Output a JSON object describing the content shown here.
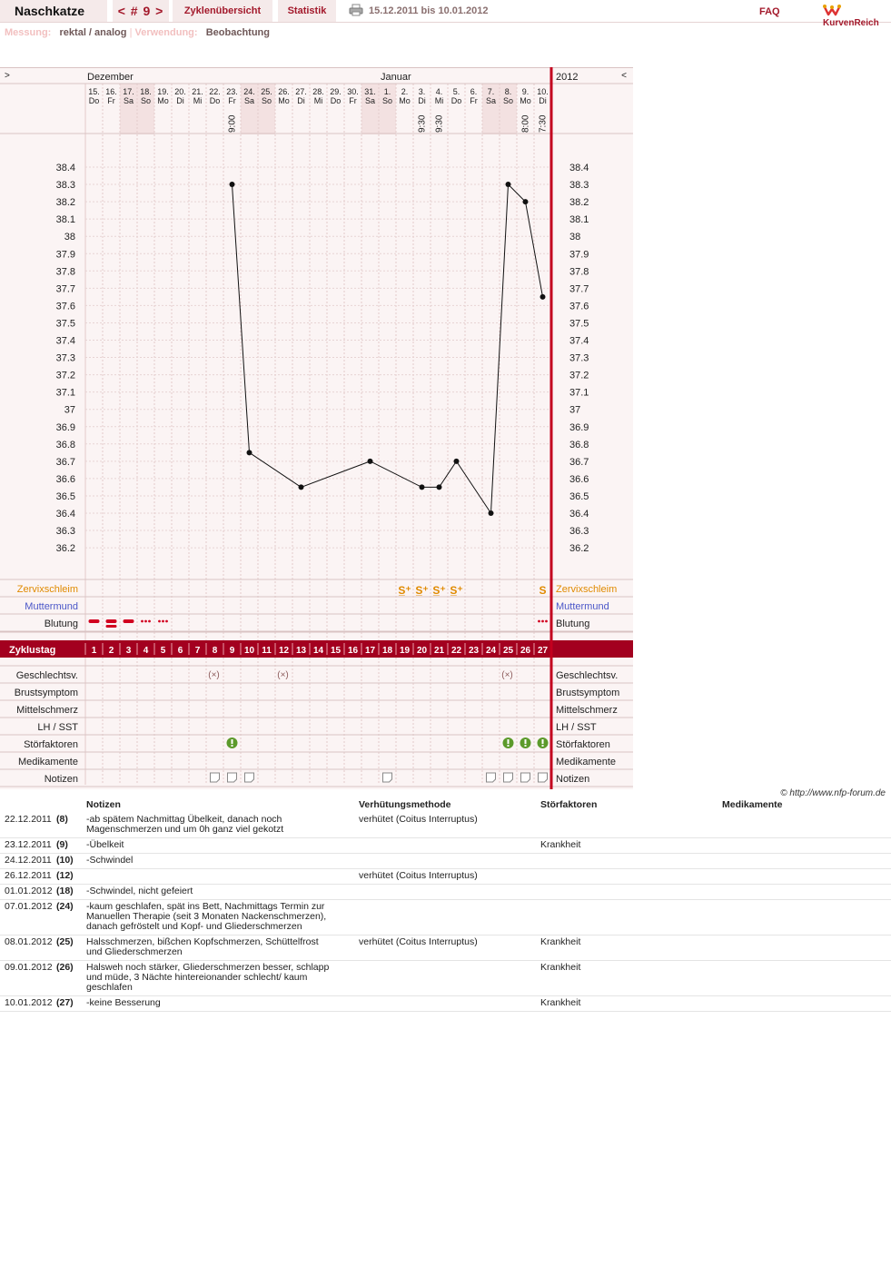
{
  "header": {
    "user": "Naschkatze",
    "cycle_nav": "< # 9 >",
    "overview_label": "Zyklenübersicht",
    "stats_label": "Statistik",
    "date_range": "15.12.2011 bis 10.01.2012",
    "faq_label": "FAQ",
    "brand": "KurvenReich"
  },
  "meta": {
    "measurement_label": "Messung:",
    "measurement_value": "rektal / analog",
    "usage_label": "Verwendung:",
    "usage_value": "Beobachtung"
  },
  "chart": {
    "nav_prev": ">",
    "nav_next": "<",
    "months": [
      "Dezember",
      "Januar"
    ],
    "year": "2012",
    "days": [
      {
        "date": "15.",
        "wd": "Do"
      },
      {
        "date": "16.",
        "wd": "Fr"
      },
      {
        "date": "17.",
        "wd": "Sa"
      },
      {
        "date": "18.",
        "wd": "So"
      },
      {
        "date": "19.",
        "wd": "Mo"
      },
      {
        "date": "20.",
        "wd": "Di"
      },
      {
        "date": "21.",
        "wd": "Mi"
      },
      {
        "date": "22.",
        "wd": "Do"
      },
      {
        "date": "23.",
        "wd": "Fr"
      },
      {
        "date": "24.",
        "wd": "Sa"
      },
      {
        "date": "25.",
        "wd": "So"
      },
      {
        "date": "26.",
        "wd": "Mo"
      },
      {
        "date": "27.",
        "wd": "Di"
      },
      {
        "date": "28.",
        "wd": "Mi"
      },
      {
        "date": "29.",
        "wd": "Do"
      },
      {
        "date": "30.",
        "wd": "Fr"
      },
      {
        "date": "31.",
        "wd": "Sa"
      },
      {
        "date": "1.",
        "wd": "So"
      },
      {
        "date": "2.",
        "wd": "Mo"
      },
      {
        "date": "3.",
        "wd": "Di"
      },
      {
        "date": "4.",
        "wd": "Mi"
      },
      {
        "date": "5.",
        "wd": "Do"
      },
      {
        "date": "6.",
        "wd": "Fr"
      },
      {
        "date": "7.",
        "wd": "Sa"
      },
      {
        "date": "8.",
        "wd": "So"
      },
      {
        "date": "9.",
        "wd": "Mo"
      },
      {
        "date": "10.",
        "wd": "Di"
      }
    ],
    "weekend_days": [
      3,
      4,
      10,
      11,
      17,
      18,
      24,
      25
    ],
    "times": [
      {
        "day": 9,
        "time": "9:00"
      },
      {
        "day": 20,
        "time": "9:30"
      },
      {
        "day": 21,
        "time": "9:30"
      },
      {
        "day": 26,
        "time": "8:00"
      },
      {
        "day": 27,
        "time": "7:30"
      }
    ],
    "y_ticks": [
      "38.4",
      "38.3",
      "38.2",
      "38.1",
      "38",
      "37.9",
      "37.8",
      "37.7",
      "37.6",
      "37.5",
      "37.4",
      "37.3",
      "37.2",
      "37.1",
      "37",
      "36.9",
      "36.8",
      "36.7",
      "36.6",
      "36.5",
      "36.4",
      "36.3",
      "36.2"
    ],
    "row_labels_left": [
      "Zervixschleim",
      "Muttermund",
      "Blutung"
    ],
    "cycle_day_label": "Zyklustag",
    "cycle_days": [
      "1",
      "2",
      "3",
      "4",
      "5",
      "6",
      "7",
      "8",
      "9",
      "10",
      "11",
      "12",
      "13",
      "14",
      "15",
      "16",
      "17",
      "18",
      "19",
      "20",
      "21",
      "22",
      "23",
      "24",
      "25",
      "26",
      "27"
    ],
    "bottom_rows": [
      "Geschlechtsv.",
      "Brustsymptom",
      "Mittelschmerz",
      "LH / SST",
      "Störfaktoren",
      "Medikamente",
      "Notizen"
    ],
    "right_labels": [
      "Zervixschleim",
      "Muttermund",
      "Blutung",
      "Geschlechtsv.",
      "Brustsymptom",
      "Mittelschmerz",
      "LH / SST",
      "Störfaktoren",
      "Medikamente",
      "Notizen"
    ],
    "colors": {
      "accent": "#a3001f",
      "mucus": "#e08a00",
      "cervix": "#4a56c8",
      "weekend": "#f3e1e1",
      "panel": "#fbf4f4"
    },
    "mucus_days": [
      19,
      20,
      21,
      22,
      27
    ],
    "mucus_symbols": [
      "S̲⁺",
      "S̲⁺",
      "S̲⁺",
      "S̲⁺",
      "S"
    ],
    "bleeding": [
      {
        "day": 1,
        "type": "heavy"
      },
      {
        "day": 2,
        "type": "heavy"
      },
      {
        "day": 3,
        "type": "heavy"
      },
      {
        "day": 4,
        "type": "spotting"
      },
      {
        "day": 5,
        "type": "spotting"
      },
      {
        "day": 27,
        "type": "spotting"
      }
    ],
    "intercourse_days": [
      8,
      12,
      25
    ],
    "disturbance_days": [
      9,
      25,
      26,
      27
    ],
    "note_days": [
      8,
      9,
      10,
      18,
      24,
      25,
      26,
      27
    ]
  },
  "chart_data": {
    "type": "line",
    "x": [
      9,
      10,
      13,
      17,
      20,
      21,
      22,
      24,
      25,
      26,
      27
    ],
    "values": [
      38.3,
      36.75,
      36.55,
      36.7,
      36.55,
      36.55,
      36.7,
      36.4,
      38.3,
      38.2,
      37.65
    ],
    "xlabel": "Zyklustag",
    "ylabel": "",
    "ylim": [
      36.2,
      38.4
    ]
  },
  "copyright": "© http://www.nfp-forum.de",
  "notes": {
    "headers": [
      "Notizen",
      "Verhütungsmethode",
      "Störfaktoren",
      "Medikamente"
    ],
    "rows": [
      {
        "date": "22.12.2011",
        "day": "(8)",
        "note": "-ab spätem Nachmittag Übelkeit, danach noch Magenschmerzen und um 0h ganz viel gekotzt",
        "method": "verhütet (Coitus Interruptus)",
        "factor": "",
        "meds": ""
      },
      {
        "date": "23.12.2011",
        "day": "(9)",
        "note": "-Übelkeit",
        "method": "",
        "factor": "Krankheit",
        "meds": ""
      },
      {
        "date": "24.12.2011",
        "day": "(10)",
        "note": "-Schwindel",
        "method": "",
        "factor": "",
        "meds": ""
      },
      {
        "date": "26.12.2011",
        "day": "(12)",
        "note": "",
        "method": "verhütet (Coitus Interruptus)",
        "factor": "",
        "meds": ""
      },
      {
        "date": "01.01.2012",
        "day": "(18)",
        "note": "-Schwindel, nicht gefeiert",
        "method": "",
        "factor": "",
        "meds": ""
      },
      {
        "date": "07.01.2012",
        "day": "(24)",
        "note": "-kaum geschlafen, spät ins Bett, Nachmittags Termin zur Manuellen Therapie (seit 3 Monaten Nackenschmerzen), danach gefröstelt und Kopf- und Gliederschmerzen",
        "method": "",
        "factor": "",
        "meds": ""
      },
      {
        "date": "08.01.2012",
        "day": "(25)",
        "note": "Halsschmerzen, bißchen Kopfschmerzen, Schüttelfrost und Gliederschmerzen",
        "method": "verhütet (Coitus Interruptus)",
        "factor": "Krankheit",
        "meds": ""
      },
      {
        "date": "09.01.2012",
        "day": "(26)",
        "note": "Halsweh noch stärker, Gliederschmerzen besser, schlapp und müde, 3 Nächte hintereionander schlecht/ kaum geschlafen",
        "method": "",
        "factor": "Krankheit",
        "meds": ""
      },
      {
        "date": "10.01.2012",
        "day": "(27)",
        "note": "-keine Besserung",
        "method": "",
        "factor": "Krankheit",
        "meds": ""
      }
    ]
  }
}
